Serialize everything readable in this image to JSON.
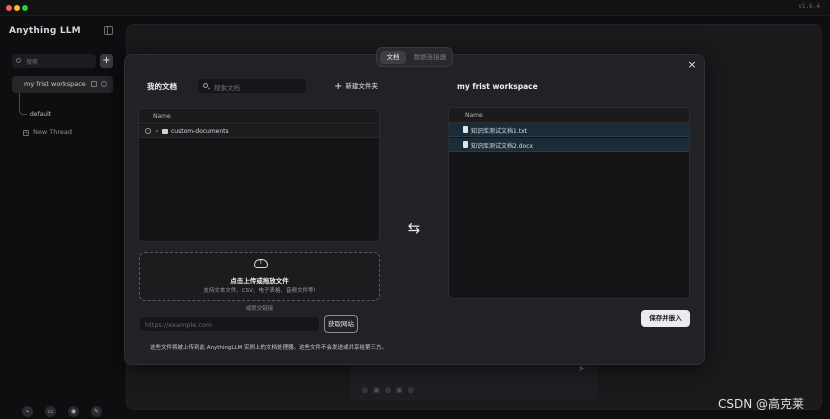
{
  "window": {
    "version": "v1.6.4"
  },
  "sidebar": {
    "logo": "Anything LLM",
    "search_placeholder": "搜索",
    "add_label": "+",
    "workspace": "my frist workspace",
    "threads": [
      {
        "label": "default"
      },
      {
        "label": "New Thread"
      }
    ]
  },
  "modal": {
    "tabs": [
      {
        "label": "文档",
        "active": true
      },
      {
        "label": "数据连接器",
        "active": false
      }
    ],
    "close_label": "×",
    "left": {
      "title": "我的文档",
      "search_placeholder": "搜索文档",
      "new_folder_label": "新建文件夹",
      "table_header": "Name",
      "folder_name": "custom-documents",
      "upload_title": "点击上传或拖放文件",
      "upload_subtitle": "支持文本文件、CSV、电子表格、音频文件等!",
      "link_label": "或提交链接",
      "url_placeholder": "https://example.com",
      "fetch_button": "获取网站",
      "footnote": "这些文件将被上传到此 AnythingLLM 实例上的文档处理器。这些文件不会发送或共享给第三方。"
    },
    "swap_icon": "swap-arrows-icon",
    "right": {
      "title": "my frist workspace",
      "table_header": "Name",
      "files": [
        {
          "name": "知识库测试文档1.txt"
        },
        {
          "name": "知识库测试文档2.docx"
        }
      ],
      "save_button": "保存并嵌入"
    }
  },
  "watermark": "CSDN @高克莱"
}
